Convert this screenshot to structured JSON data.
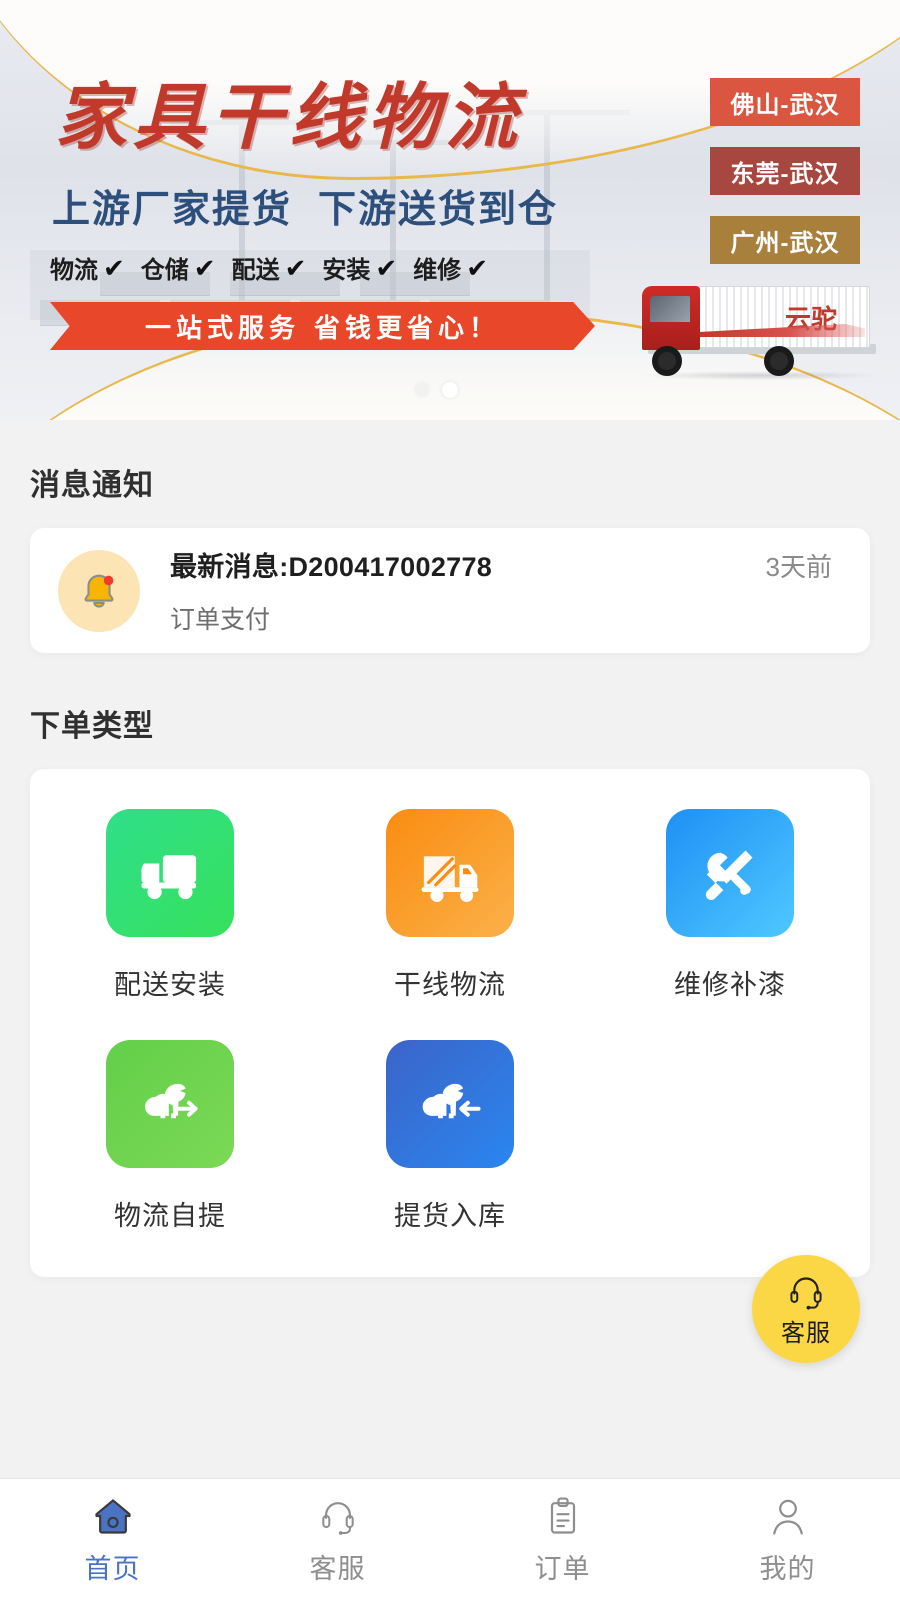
{
  "banner": {
    "title": "家具干线物流",
    "subtitle_left": "上游厂家提货",
    "subtitle_right": "下游送货到仓",
    "features": [
      {
        "label": "物流",
        "check": "✔"
      },
      {
        "label": "仓储",
        "check": "✔"
      },
      {
        "label": "配送",
        "check": "✔"
      },
      {
        "label": "安装",
        "check": "✔"
      },
      {
        "label": "维修",
        "check": "✔"
      }
    ],
    "ribbon_left": "一站式服务",
    "ribbon_right": "省钱更省心！",
    "routes": [
      {
        "label": "佛山-武汉",
        "color": "#db5640"
      },
      {
        "label": "东莞-武汉",
        "color": "#a8473f"
      },
      {
        "label": "广州-武汉",
        "color": "#a8803b"
      }
    ],
    "truck_logo": "云驼",
    "gold_accent": "#e8b84b",
    "title_color": "#c0392b",
    "subtitle_color": "#2c4f7c",
    "ribbon_color": "#e8472a"
  },
  "notice": {
    "section_title": "消息通知",
    "icon": "bell-icon",
    "title": "最新消息:D200417002778",
    "time": "3天前",
    "desc": "订单支付"
  },
  "order_types": {
    "section_title": "下单类型",
    "items": [
      {
        "label": "配送安装",
        "icon": "delivery-truck-icon",
        "color_from": "#2fdf8a",
        "color_to": "#36e05c"
      },
      {
        "label": "干线物流",
        "icon": "line-haul-truck-icon",
        "color_from": "#fa8c10",
        "color_to": "#fbb14a"
      },
      {
        "label": "维修补漆",
        "icon": "tools-icon",
        "color_from": "#1e90f5",
        "color_to": "#4fc8ff"
      },
      {
        "label": "物流自提",
        "icon": "camel-arrow-right-icon",
        "color_from": "#63cf4a",
        "color_to": "#7bd956"
      },
      {
        "label": "提货入库",
        "icon": "camel-arrow-left-icon",
        "color_from": "#3c64c8",
        "color_to": "#2a86ef"
      }
    ]
  },
  "fab": {
    "label": "客服",
    "icon": "headset-icon",
    "color": "#fbd745"
  },
  "tabbar": {
    "active_color": "#4a73c4",
    "items": [
      {
        "label": "首页",
        "icon": "home-icon",
        "active": true
      },
      {
        "label": "客服",
        "icon": "headset-icon",
        "active": false
      },
      {
        "label": "订单",
        "icon": "clipboard-icon",
        "active": false
      },
      {
        "label": "我的",
        "icon": "person-icon",
        "active": false
      }
    ]
  }
}
